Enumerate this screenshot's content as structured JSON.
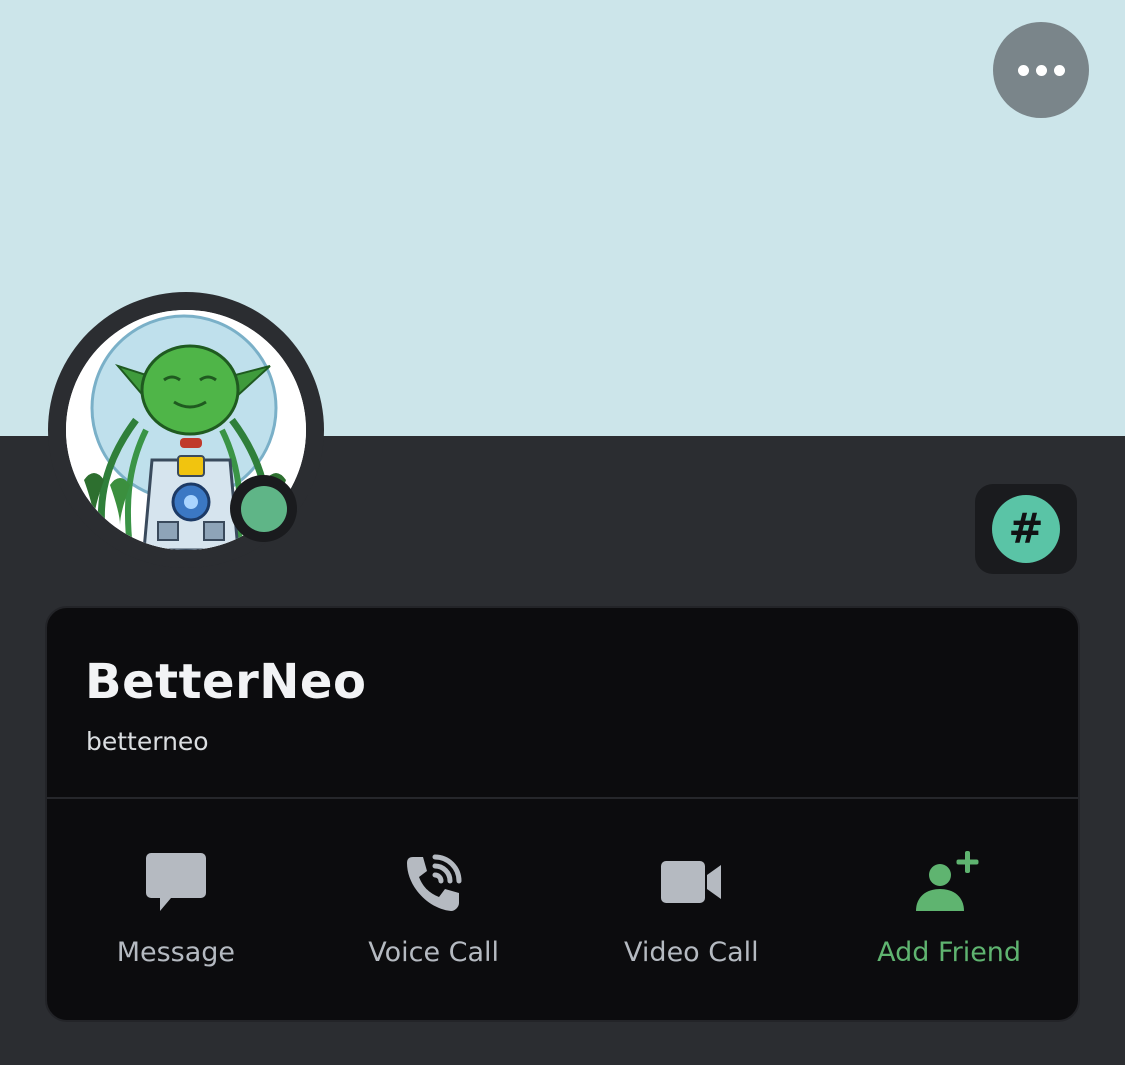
{
  "header": {
    "more_icon": "more-horizontal-icon"
  },
  "profile": {
    "display_name": "BetterNeo",
    "username": "betterneo",
    "status": "online",
    "status_color": "#5fb587",
    "banner_color": "#cce5ea",
    "badge_icon": "hashtag-icon",
    "badge_text": "#",
    "badge_color": "#5ac4a6"
  },
  "actions": [
    {
      "label": "Message",
      "icon": "chat-bubble-icon"
    },
    {
      "label": "Voice Call",
      "icon": "phone-icon"
    },
    {
      "label": "Video Call",
      "icon": "video-camera-icon"
    },
    {
      "label": "Add Friend",
      "icon": "add-friend-icon"
    }
  ],
  "colors": {
    "background": "#2b2d31",
    "card": "#0c0c0e",
    "action_icon": "#b5bac1",
    "add_friend": "#5fb470"
  }
}
